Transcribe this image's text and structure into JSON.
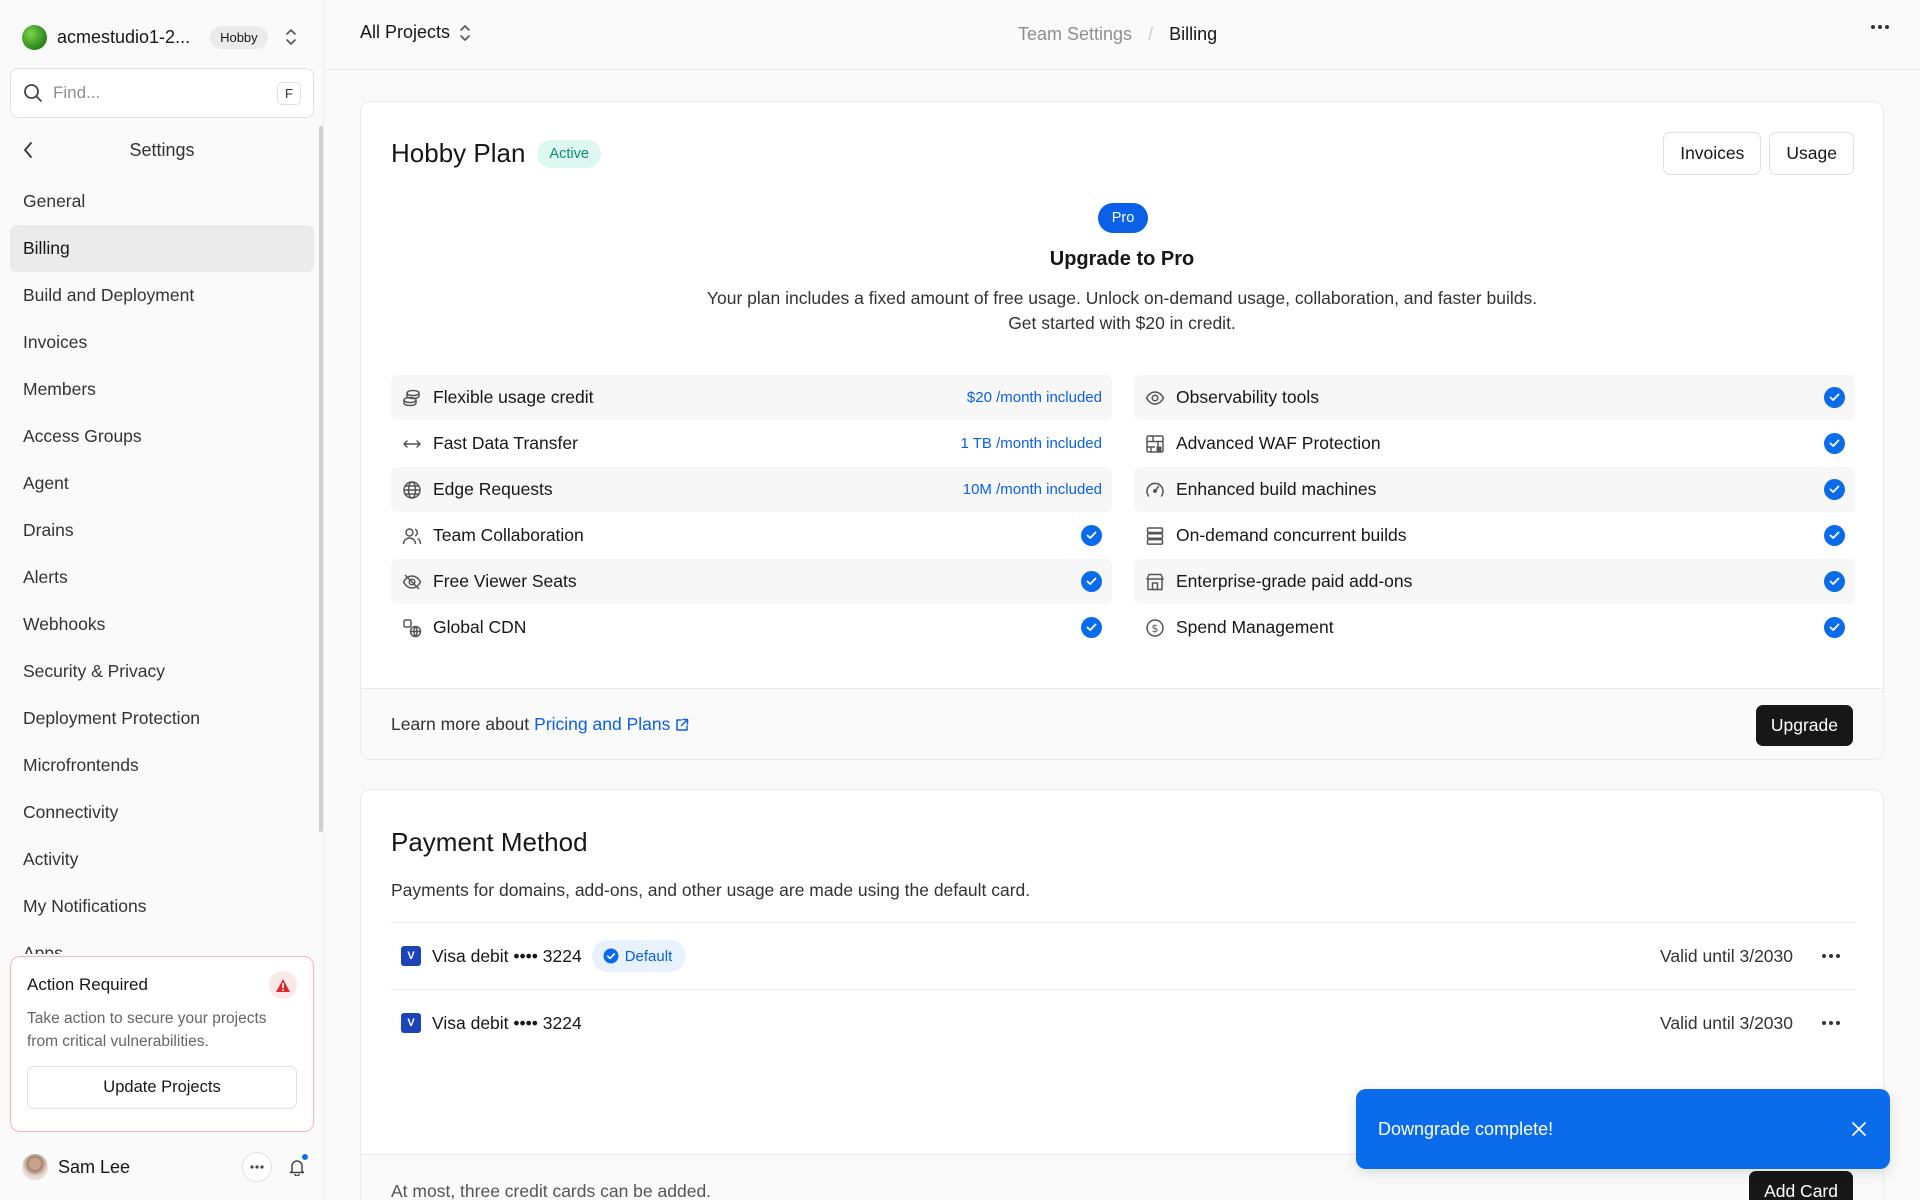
{
  "sidebar": {
    "team_name": "acmestudio1-2...",
    "plan_pill": "Hobby",
    "search_placeholder": "Find...",
    "search_shortcut": "F",
    "section_title": "Settings",
    "items": [
      {
        "label": "General"
      },
      {
        "label": "Billing",
        "active": true
      },
      {
        "label": "Build and Deployment"
      },
      {
        "label": "Invoices"
      },
      {
        "label": "Members"
      },
      {
        "label": "Access Groups"
      },
      {
        "label": "Agent"
      },
      {
        "label": "Drains"
      },
      {
        "label": "Alerts"
      },
      {
        "label": "Webhooks"
      },
      {
        "label": "Security & Privacy"
      },
      {
        "label": "Deployment Protection"
      },
      {
        "label": "Microfrontends"
      },
      {
        "label": "Connectivity"
      },
      {
        "label": "Activity"
      },
      {
        "label": "My Notifications"
      },
      {
        "label": "Apps"
      }
    ],
    "action_card": {
      "title": "Action Required",
      "text": "Take action to secure your projects from critical vulnerabilities.",
      "button": "Update Projects"
    },
    "user": {
      "name": "Sam Lee"
    }
  },
  "topbar": {
    "projects_label": "All Projects",
    "breadcrumb": [
      "Team Settings",
      "Billing"
    ]
  },
  "plan": {
    "title": "Hobby Plan",
    "status": "Active",
    "buttons": {
      "invoices": "Invoices",
      "usage": "Usage"
    },
    "pro_pill": "Pro",
    "upgrade_title": "Upgrade to Pro",
    "upgrade_desc_line1": "Your plan includes a fixed amount of free usage. Unlock on-demand usage, collaboration, and faster builds.",
    "upgrade_desc_line2": "Get started with $20 in credit.",
    "features_left": [
      {
        "icon": "coins-icon",
        "label": "Flexible usage credit",
        "value": "$20 /month included"
      },
      {
        "icon": "arrows-horizontal-icon",
        "label": "Fast Data Transfer",
        "value": "1 TB /month included"
      },
      {
        "icon": "globe-icon",
        "label": "Edge Requests",
        "value": "10M /month included"
      },
      {
        "icon": "users-icon",
        "label": "Team Collaboration",
        "value": null
      },
      {
        "icon": "eye-off-icon",
        "label": "Free Viewer Seats",
        "value": null
      },
      {
        "icon": "cdn-icon",
        "label": "Global CDN",
        "value": null
      }
    ],
    "features_right": [
      {
        "icon": "eye-icon",
        "label": "Observability tools"
      },
      {
        "icon": "firewall-icon",
        "label": "Advanced WAF Protection"
      },
      {
        "icon": "gauge-icon",
        "label": "Enhanced build machines"
      },
      {
        "icon": "servers-icon",
        "label": "On-demand concurrent builds"
      },
      {
        "icon": "store-icon",
        "label": "Enterprise-grade paid add-ons"
      },
      {
        "icon": "dollar-icon",
        "label": "Spend Management"
      }
    ],
    "learn_prefix": "Learn more about",
    "learn_link": "Pricing and Plans",
    "upgrade_button": "Upgrade"
  },
  "payment": {
    "title": "Payment Method",
    "desc": "Payments for domains, add-ons, and other usage are made using the default card.",
    "cards": [
      {
        "brand_letter": "V",
        "label": "Visa debit •••• 3224",
        "default_label": "Default",
        "valid": "Valid until 3/2030"
      },
      {
        "brand_letter": "V",
        "label": "Visa debit •••• 3224",
        "default_label": null,
        "valid": "Valid until 3/2030"
      }
    ],
    "footer_note": "At most, three credit cards can be added.",
    "add_card_button": "Add Card"
  },
  "toast": {
    "message": "Downgrade complete!"
  },
  "colors": {
    "accent": "#0a6cea",
    "active_badge": "#0b8f78",
    "danger": "#d92d2d"
  }
}
